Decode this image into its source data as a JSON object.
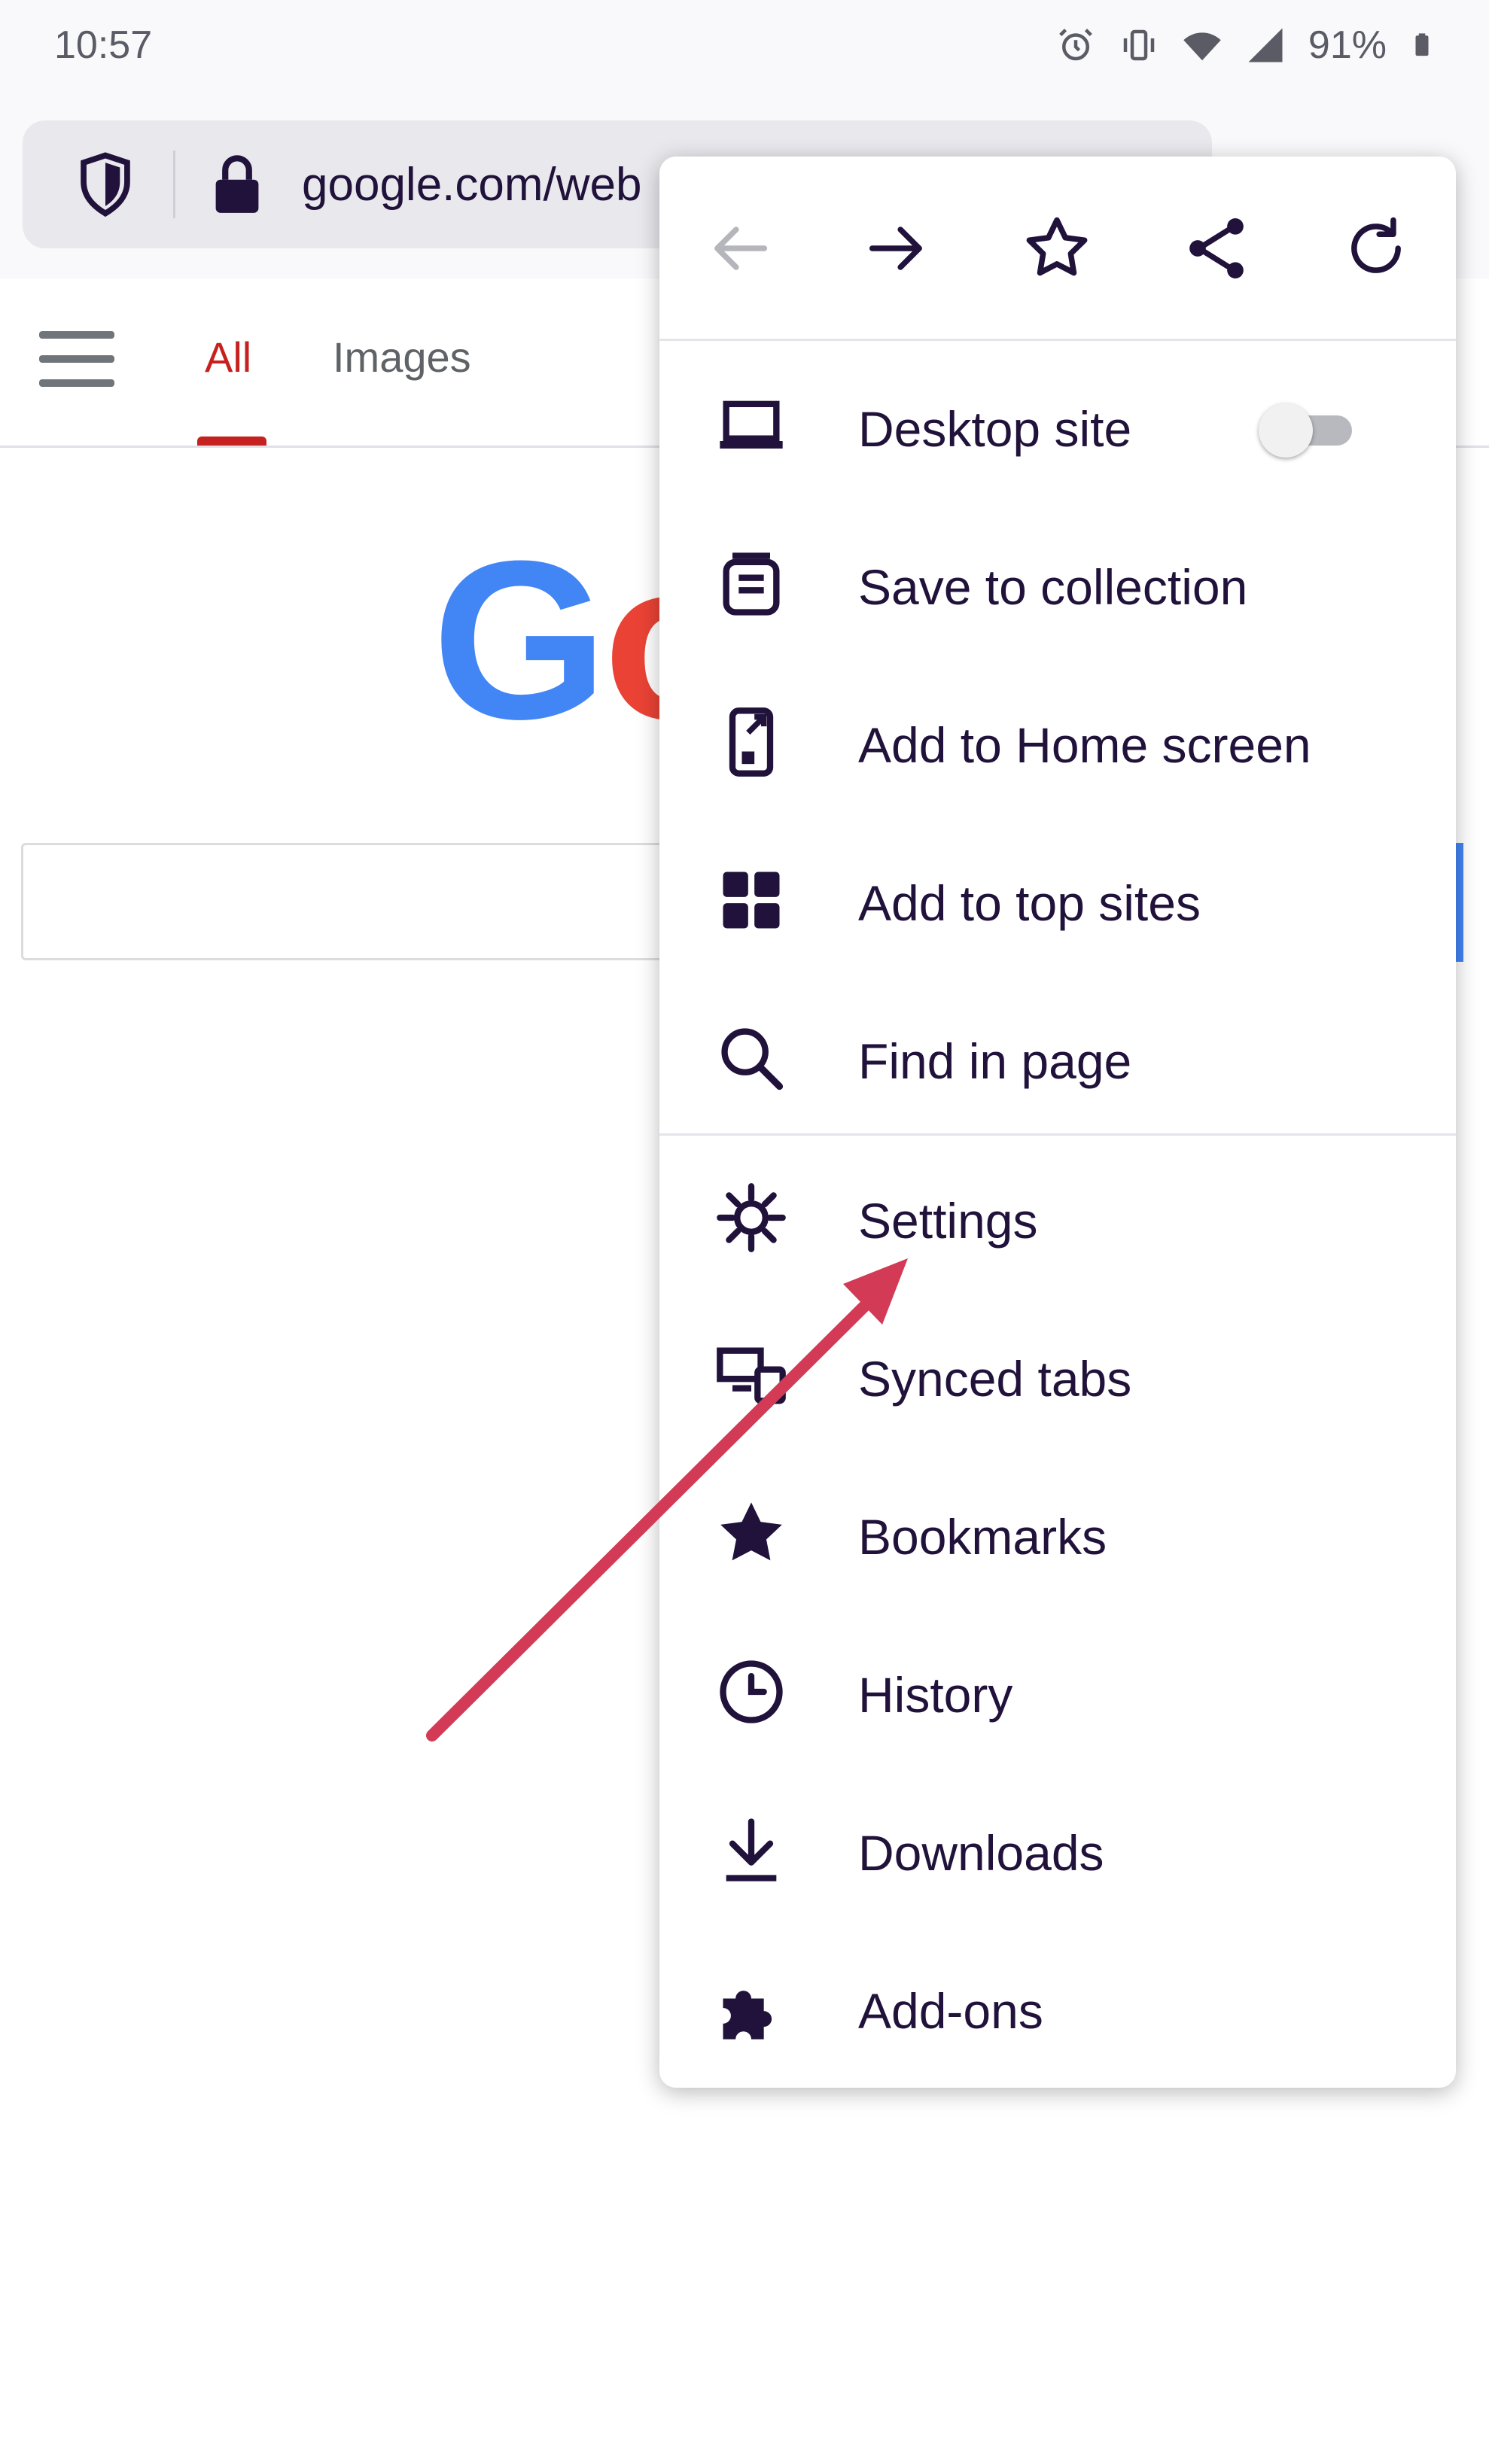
{
  "status": {
    "time": "10:57",
    "battery": "91%"
  },
  "toolbar": {
    "url": "google.com/web"
  },
  "google_tabs": {
    "all": "All",
    "images": "Images"
  },
  "logo": {
    "letters": [
      "G",
      "o"
    ],
    "colors": [
      "#4285f4",
      "#ea4335"
    ]
  },
  "menu": {
    "nav_icons": [
      "back-arrow-icon",
      "forward-arrow-icon",
      "bookmark-star-icon",
      "share-icon",
      "reload-icon"
    ],
    "items": [
      {
        "label": "Desktop site",
        "icon": "laptop-icon",
        "toggle": "off"
      },
      {
        "label": "Save to collection",
        "icon": "collection-icon"
      },
      {
        "label": "Add to Home screen",
        "icon": "add-home-screen-icon"
      },
      {
        "label": "Add to top sites",
        "icon": "top-sites-grid-icon"
      },
      {
        "label": "Find in page",
        "icon": "search-icon"
      },
      {
        "label": "Settings",
        "icon": "gear-icon"
      },
      {
        "label": "Synced tabs",
        "icon": "synced-devices-icon"
      },
      {
        "label": "Bookmarks",
        "icon": "star-filled-icon"
      },
      {
        "label": "History",
        "icon": "clock-icon"
      },
      {
        "label": "Downloads",
        "icon": "download-icon"
      },
      {
        "label": "Add-ons",
        "icon": "puzzle-piece-icon"
      }
    ]
  },
  "colors": {
    "accent_arrow": "#d23a55",
    "tab_active": "#c5221f",
    "menu_text": "#20123a"
  }
}
